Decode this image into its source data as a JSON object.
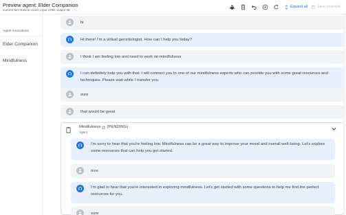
{
  "header": {
    "title": "Preview agent: Elder Companion",
    "token_info": "Current turn tokens count: input 1796, output 38",
    "expand_all_label": "Expand all",
    "save_example_label": "Save example"
  },
  "sidebar": {
    "header": "Agent invocations",
    "items": [
      {
        "label": "Elder Companion"
      },
      {
        "label": "Mindfulness"
      }
    ]
  },
  "conversation": {
    "messages": [
      {
        "role": "user",
        "text": "hi"
      },
      {
        "role": "bot",
        "text": "Hi there! I'm a virtual gerontologist. How can I help you today?"
      },
      {
        "role": "user",
        "text": "I think I am feeling low and need to work on mindfulness"
      },
      {
        "role": "bot",
        "text": "I can definitely help you with that. I will connect you to one of our mindfulness experts who can provide you with some great resources and techniques. Please wait while I transfer you."
      },
      {
        "role": "user",
        "text": "sure"
      },
      {
        "role": "user",
        "text": "that would be great"
      }
    ],
    "subagent": {
      "name": "Mindfulness",
      "status": "(PENDING)",
      "type": "Agent",
      "messages": [
        {
          "role": "bot",
          "text": "I'm sorry to hear that you're feeling low. Mindfulness can be a great way to improve your mood and overall well-being. Let's explore some resources that can help you get started."
        },
        {
          "role": "user",
          "text": "nice"
        },
        {
          "role": "bot",
          "text": "I'm glad to hear that you're interested in exploring mindfulness. Let's get started with some questions to help me find the perfect resources for you."
        },
        {
          "role": "user",
          "text": "sure"
        }
      ]
    }
  },
  "colors": {
    "accent": "#1a73e8",
    "bot_bubble": "#e8f0fe",
    "user_bubble": "#f1f3f4"
  },
  "icons": {
    "toolbar": [
      "bug-icon",
      "clipboard-icon",
      "undo-icon",
      "play-icon",
      "reset-icon"
    ],
    "user_avatar": "person-icon",
    "bot_avatar": "headset-icon",
    "agent": "clipboard-icon",
    "external_link": "open-in-new-icon",
    "expand": "chevron-down-icon"
  }
}
